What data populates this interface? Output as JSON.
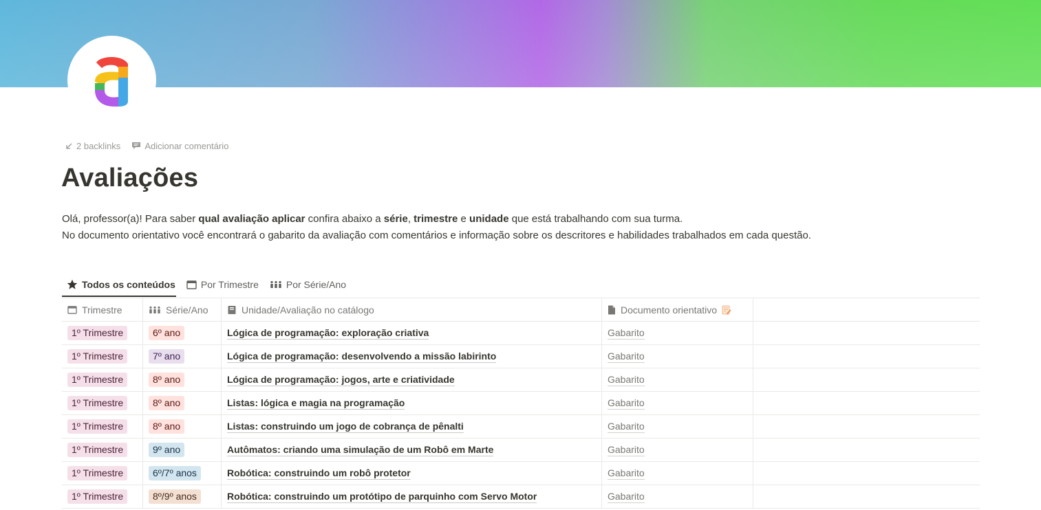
{
  "meta": {
    "backlinks": "2 backlinks",
    "comment": "Adicionar comentário"
  },
  "page": {
    "title": "Avaliações"
  },
  "description": {
    "line1_a": "Olá, professor(a)! Para saber ",
    "line1_b": "qual avaliação aplicar",
    "line1_c": " confira abaixo a ",
    "line1_d": "série",
    "line1_e": ", ",
    "line1_f": "trimestre",
    "line1_g": " e ",
    "line1_h": "unidade",
    "line1_i": " que está trabalhando com sua turma.",
    "line2": "No documento orientativo você encontrará o gabarito da avaliação com comentários e informação sobre os descritores e habilidades trabalhados em cada questão."
  },
  "tabs": [
    {
      "label": "Todos os conteúdos",
      "icon": "star-icon",
      "active": true
    },
    {
      "label": "Por Trimestre",
      "icon": "calendar-icon",
      "active": false
    },
    {
      "label": "Por Série/Ano",
      "icon": "people-icon",
      "active": false
    }
  ],
  "table": {
    "headers": [
      "Trimestre",
      "Série/Ano",
      "Unidade/Avaliação no catálogo",
      "Documento orientativo"
    ],
    "rows": [
      {
        "trimestre": "1º Trimestre",
        "serie": "6º ano",
        "serie_color": "red",
        "unidade": "Lógica de programação: exploração criativa",
        "doc": "Gabarito"
      },
      {
        "trimestre": "1º Trimestre",
        "serie": "7º ano",
        "serie_color": "purple",
        "unidade": "Lógica de programação: desenvolvendo a missão labirinto",
        "doc": "Gabarito"
      },
      {
        "trimestre": "1º Trimestre",
        "serie": "8º ano",
        "serie_color": "red",
        "unidade": "Lógica de programação: jogos, arte e criatividade",
        "doc": "Gabarito"
      },
      {
        "trimestre": "1º Trimestre",
        "serie": "8º ano",
        "serie_color": "red",
        "unidade": "Listas: lógica e magia na programação",
        "doc": "Gabarito"
      },
      {
        "trimestre": "1º Trimestre",
        "serie": "8º ano",
        "serie_color": "red",
        "unidade": "Listas: construindo um jogo de cobrança de pênalti",
        "doc": "Gabarito"
      },
      {
        "trimestre": "1º Trimestre",
        "serie": "9º ano",
        "serie_color": "blue",
        "unidade": "Autômatos: criando uma simulação de um Robô em Marte",
        "doc": "Gabarito"
      },
      {
        "trimestre": "1º Trimestre",
        "serie": "6º/7º anos",
        "serie_color": "blue",
        "unidade": "Robótica: construindo um robô protetor",
        "doc": "Gabarito"
      },
      {
        "trimestre": "1º Trimestre",
        "serie": "8º/9º anos",
        "serie_color": "brown",
        "unidade": "Robótica: construindo um protótipo de parquinho com Servo Motor",
        "doc": "Gabarito"
      }
    ]
  }
}
